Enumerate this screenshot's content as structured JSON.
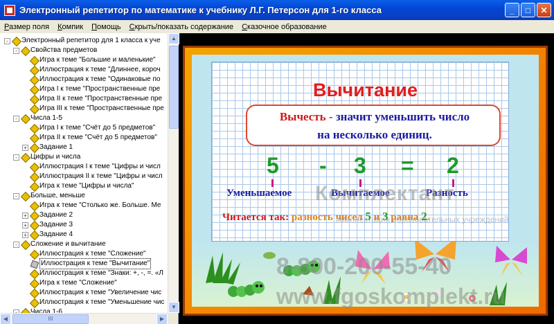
{
  "window": {
    "title": "Электронный репетитор по математике к учебнику Л.Г. Петерсон для 1-го класса",
    "minimize": "_",
    "maximize": "□",
    "close": "✕"
  },
  "menu": [
    {
      "label": "Размер поля",
      "ul": "Р"
    },
    {
      "label": "Компик",
      "ul": "К"
    },
    {
      "label": "Помощь",
      "ul": "П"
    },
    {
      "label": "Скрыть/показать содержание",
      "ul": "С"
    },
    {
      "label": "Сказочное образование",
      "ul": "С"
    }
  ],
  "tree": [
    {
      "level": 0,
      "exp": "-",
      "icon": "diamond",
      "label": "Электронный репетитор для 1 класса к уче"
    },
    {
      "level": 1,
      "exp": "-",
      "icon": "diamond",
      "label": "Свойства предметов"
    },
    {
      "level": 2,
      "exp": "",
      "icon": "diamond",
      "label": "Игра к теме \"Большие и маленькие\""
    },
    {
      "level": 2,
      "exp": "",
      "icon": "diamond",
      "label": "Иллюстрация к теме \"Длиннее, короч"
    },
    {
      "level": 2,
      "exp": "",
      "icon": "diamond",
      "label": "Иллюстрация к теме \"Одинаковые по"
    },
    {
      "level": 2,
      "exp": "",
      "icon": "diamond",
      "label": "Игра I к теме \"Пространственные пре"
    },
    {
      "level": 2,
      "exp": "",
      "icon": "diamond",
      "label": "Игра II к теме \"Пространственные пре"
    },
    {
      "level": 2,
      "exp": "",
      "icon": "diamond",
      "label": "Игра III к теме \"Пространственные пре"
    },
    {
      "level": 1,
      "exp": "-",
      "icon": "diamond",
      "label": "Числа 1-5"
    },
    {
      "level": 2,
      "exp": "",
      "icon": "diamond",
      "label": "Игра I к теме \"Счёт до 5 предметов\""
    },
    {
      "level": 2,
      "exp": "",
      "icon": "diamond",
      "label": "Игра II к теме \"Счёт до 5 предметов\""
    },
    {
      "level": 2,
      "exp": "+",
      "icon": "diamond",
      "label": "Задание 1"
    },
    {
      "level": 1,
      "exp": "-",
      "icon": "diamond",
      "label": "Цифры и числа"
    },
    {
      "level": 2,
      "exp": "",
      "icon": "diamond",
      "label": "Иллюстрация I к теме \"Цифры и числ"
    },
    {
      "level": 2,
      "exp": "",
      "icon": "diamond",
      "label": "Иллюстрация II к теме \"Цифры и числ"
    },
    {
      "level": 2,
      "exp": "",
      "icon": "diamond",
      "label": "Игра к теме \"Цифры и числа\""
    },
    {
      "level": 1,
      "exp": "-",
      "icon": "diamond",
      "label": "Больше, меньше"
    },
    {
      "level": 2,
      "exp": "",
      "icon": "diamond",
      "label": "Игра к теме \"Столько же. Больше. Ме"
    },
    {
      "level": 2,
      "exp": "+",
      "icon": "diamond",
      "label": "Задание 2"
    },
    {
      "level": 2,
      "exp": "+",
      "icon": "diamond",
      "label": "Задание 3"
    },
    {
      "level": 2,
      "exp": "+",
      "icon": "diamond",
      "label": "Задание 4"
    },
    {
      "level": 1,
      "exp": "-",
      "icon": "diamond",
      "label": "Сложение и вычитание"
    },
    {
      "level": 2,
      "exp": "",
      "icon": "diamond",
      "label": "Иллюстрация к теме \"Сложение\""
    },
    {
      "level": 2,
      "exp": "",
      "icon": "pencil",
      "label": "Иллюстрация к теме \"Вычитание\"",
      "selected": true
    },
    {
      "level": 2,
      "exp": "",
      "icon": "diamond",
      "label": "Иллюстрация к теме \"Знаки: +, -, =. «Л"
    },
    {
      "level": 2,
      "exp": "",
      "icon": "diamond",
      "label": "Игра к теме \"Сложение\""
    },
    {
      "level": 2,
      "exp": "",
      "icon": "diamond",
      "label": "Иллюстрация к теме \"Увеличение чис"
    },
    {
      "level": 2,
      "exp": "",
      "icon": "diamond",
      "label": "Иллюстрация к теме \"Уменьшение чис"
    },
    {
      "level": 1,
      "exp": "-",
      "icon": "diamond",
      "label": "Числа 1-6"
    }
  ],
  "scroll": {
    "grip": "III"
  },
  "slide": {
    "title": "Вычитание",
    "def_verb": "Вычесть",
    "def_dash": "-",
    "def_rest": "значит уменьшить число",
    "def_line2": "на несколько единиц.",
    "eq": {
      "a": "5",
      "minus": "-",
      "b": "3",
      "eq": "=",
      "c": "2"
    },
    "terms": {
      "minuend": "Уменьшаемое",
      "subtrahend": "Вычитаемое",
      "difference": "Разность"
    },
    "reading": {
      "prefix": "Читается так:",
      "p1": "разность чисел",
      "n1": "5",
      "and": "и",
      "n2": "3",
      "eq_word": "равна",
      "n3": "2",
      "dot": "."
    }
  },
  "watermark": {
    "brand": "Комплектант",
    "tagline": "комплектация образовательных учреждений",
    "phone": "8-800-200-55-40",
    "site": "www.fgoskomplekt.ru"
  },
  "colors": {
    "title_bar": "#0347d4",
    "menu_bg": "#ece9d8",
    "slide_frame": "#f5a300",
    "title_red": "#e21d1d",
    "eq_green": "#1e9a2a",
    "term_blue": "#1a1aa0"
  }
}
